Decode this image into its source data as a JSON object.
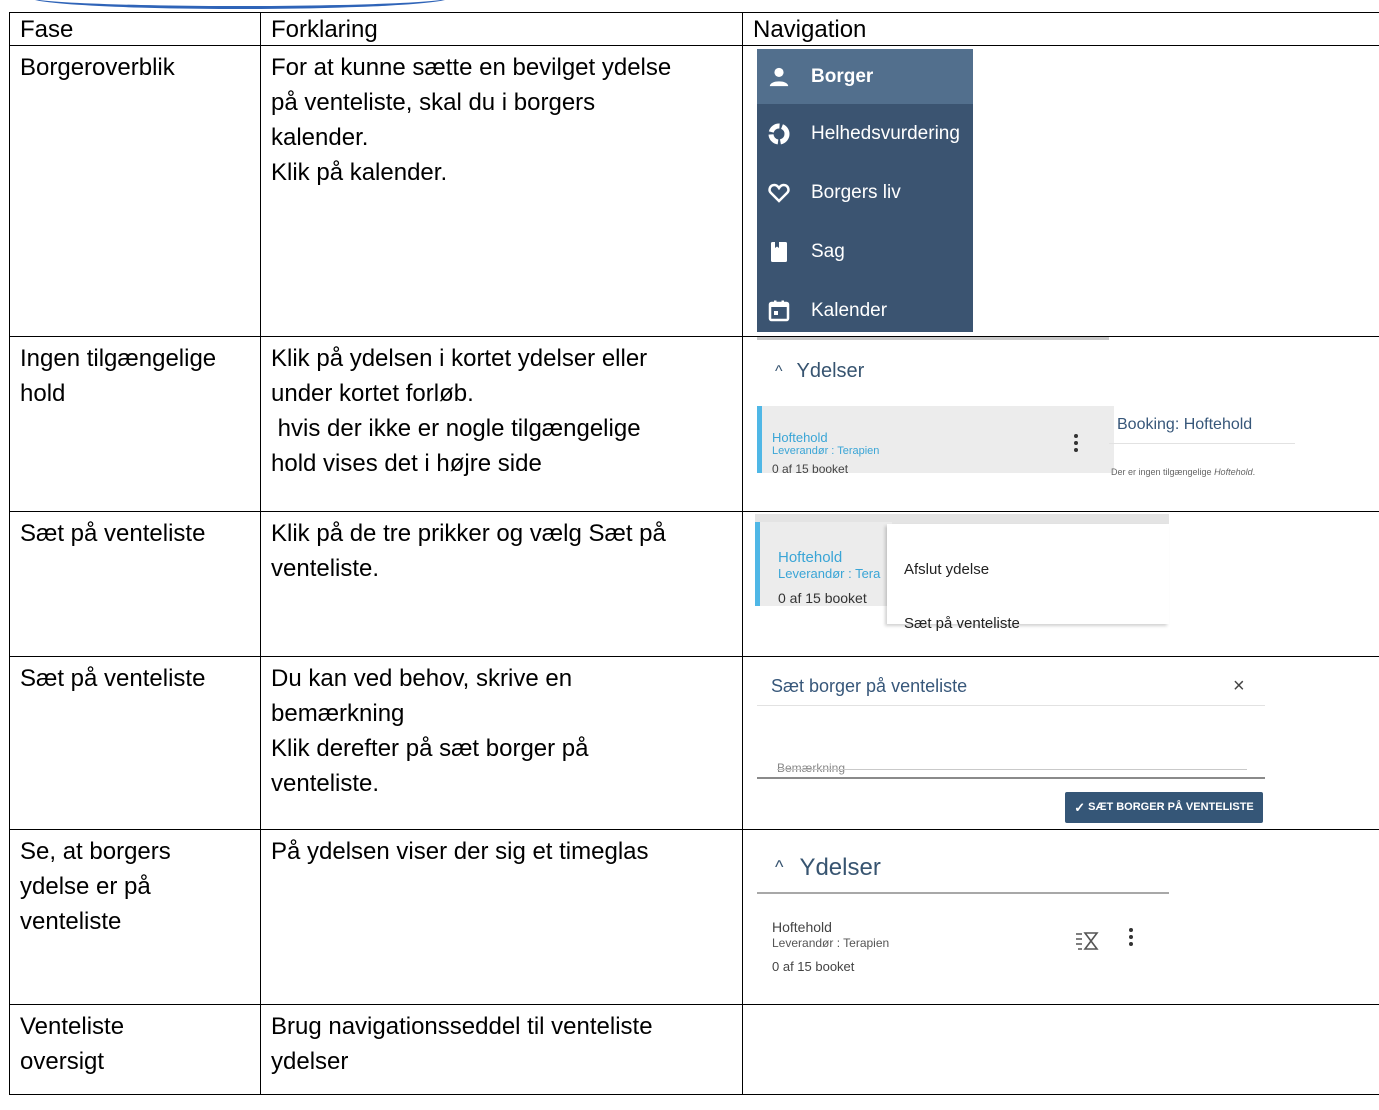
{
  "table": {
    "headers": [
      "Fase",
      "Forklaring",
      "Navigation"
    ],
    "rows": [
      {
        "fase": "Borgeroverblik",
        "forklaring": [
          "For at kunne sætte en bevilget ydelse",
          "på venteliste, skal du i borgers",
          "kalender.",
          "Klik på kalender."
        ]
      },
      {
        "fase": [
          "Ingen tilgængelige",
          "hold"
        ],
        "forklaring": [
          "Klik på ydelsen i kortet ydelser eller",
          "under kortet forløb.",
          " hvis der ikke er nogle tilgængelige",
          "hold vises det i højre side"
        ]
      },
      {
        "fase": "Sæt på venteliste",
        "forklaring": [
          "Klik på de tre prikker og vælg Sæt på",
          "venteliste."
        ]
      },
      {
        "fase": "Sæt på venteliste",
        "forklaring": [
          "Du kan ved behov, skrive en",
          "bemærkning",
          "Klik derefter på sæt borger på",
          "venteliste."
        ]
      },
      {
        "fase": [
          "Se, at borgers",
          "ydelse er på",
          "venteliste"
        ],
        "forklaring": [
          "På ydelsen viser der sig et timeglas"
        ]
      },
      {
        "fase": [
          "Venteliste",
          "oversigt"
        ],
        "forklaring": [
          "Brug navigationsseddel til venteliste",
          "ydelser"
        ]
      }
    ]
  },
  "sidebar": {
    "items": [
      {
        "label": "Borger",
        "icon": "person-icon",
        "active": true
      },
      {
        "label": "Helhedsvurdering",
        "icon": "circle-arrows-icon"
      },
      {
        "label": "Borgers liv",
        "icon": "heart-icon"
      },
      {
        "label": "Sag",
        "icon": "book-icon"
      },
      {
        "label": "Kalender",
        "icon": "calendar-icon"
      }
    ]
  },
  "shot2": {
    "section_title": "Ydelser",
    "item_name": "Hoftehold",
    "provider": "Leverandør : Terapien",
    "count": "0 af 15 booket",
    "booking_title": "Booking: Hoftehold",
    "empty_prefix": "Der er ingen tilgængelige ",
    "empty_em": "Hoftehold",
    "empty_suffix": "."
  },
  "shot3": {
    "item_name": "Hoftehold",
    "provider": "Leverandør : Tera",
    "count": "0 af 15 booket",
    "menu": [
      "Afslut ydelse",
      "Sæt på venteliste"
    ]
  },
  "shot4": {
    "dialog_title": "Sæt borger på venteliste",
    "close": "×",
    "placeholder": "Bemærkning",
    "button": "SÆT BORGER PÅ VENTELISTE"
  },
  "shot5": {
    "section_title": "Ydelser",
    "item_name": "Hoftehold",
    "provider": "Leverandør : Terapien",
    "count": "0 af 15 booket"
  },
  "colors": {
    "sidebar_bg": "#3b5471",
    "sidebar_active": "#526f8d",
    "accent_blue": "#3aa5d6",
    "dark_button": "#355677"
  }
}
